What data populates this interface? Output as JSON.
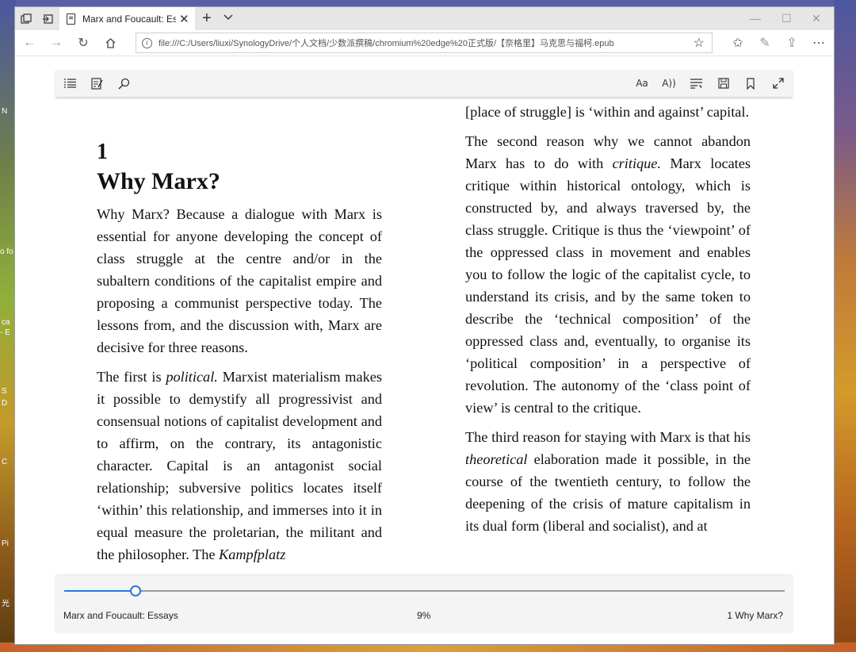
{
  "browser": {
    "tab_title": "Marx and Foucault: Essays",
    "url": "file:///C:/Users/liuxi/SynologyDrive/个人文档/少数派撰稿/chromium%20edge%20正式版/【奈格里】马克思与福柯.epub"
  },
  "desktop": {
    "labels": [
      "N",
      "o fo",
      "ca",
      "- E",
      "S",
      "D",
      "C",
      "Pi",
      "光"
    ]
  },
  "chapter": {
    "number": "1",
    "title": "Why Marx?"
  },
  "left_page": {
    "p1": "Why Marx? Because a dialogue with Marx is essential for anyone developing the concept of class struggle at the centre and/or in the subaltern conditions of the capitalist empire and proposing a communist perspective today. The lessons from, and the discussion with, Marx are decisive for three reasons.",
    "p2_a": "The first is ",
    "p2_em": "political.",
    "p2_b": " Marxist materialism makes it possible to demystify all progressivist and consensual notions of capitalist development and to affirm, on the contrary, its antagonistic character. Capital is an antagonist social relationship; subversive politics locates itself ‘within’ this relationship, and immerses into it in equal measure the proletarian, the militant and the philosopher. The ",
    "p2_em2": "Kampfplatz"
  },
  "right_page": {
    "p1": "[place of struggle] is ‘within and against’ capital.",
    "p2_a": "The second reason why we cannot abandon Marx has to do with ",
    "p2_em": "critique.",
    "p2_b": " Marx locates critique within historical ontology, which is constructed by, and always traversed by, the class struggle. Critique is thus the ‘viewpoint’ of the oppressed class in movement and enables you to follow the logic of the capitalist cycle, to understand its crisis, and by the same token to describe the ‘technical composition’ of the oppressed class and, eventually, to organise its ‘political composition’ in a perspective of revolution. The autonomy of the ‘class point of view’ is central to the critique.",
    "p3_a": "The third reason for staying with Marx is that his ",
    "p3_em": "theoretical",
    "p3_b": " elaboration made it possible, in the course of the twentieth century, to follow the deepening of the crisis of mature capitalism in its dual form (liberal and socialist), and at"
  },
  "footer": {
    "book_title": "Marx and Foucault: Essays",
    "progress_label": "9%",
    "progress": 0.099,
    "chapter_label": "1 Why Marx?"
  },
  "colors": {
    "accent": "#2b78d6"
  }
}
